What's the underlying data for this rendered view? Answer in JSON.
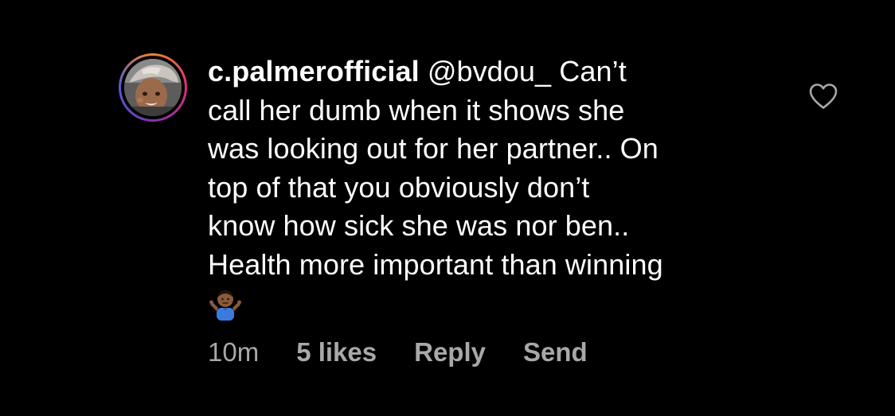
{
  "comment": {
    "username": "c.palmerofficial",
    "mention": "@bvdou_",
    "text_lines": [
      "Can’t",
      "call her dumb when it shows she",
      "was looking out for her partner.. On",
      "top of that you obviously don’t",
      "know how sick she was nor ben..",
      "Health more important than winning"
    ],
    "emoji": "man-shrugging-emoji",
    "time": "10m",
    "likes": "5 likes",
    "reply_label": "Reply",
    "send_label": "Send"
  },
  "icons": {
    "like": "heart-icon"
  },
  "colors": {
    "background": "#000000",
    "text": "#ffffff",
    "meta": "#a8a8a8"
  }
}
